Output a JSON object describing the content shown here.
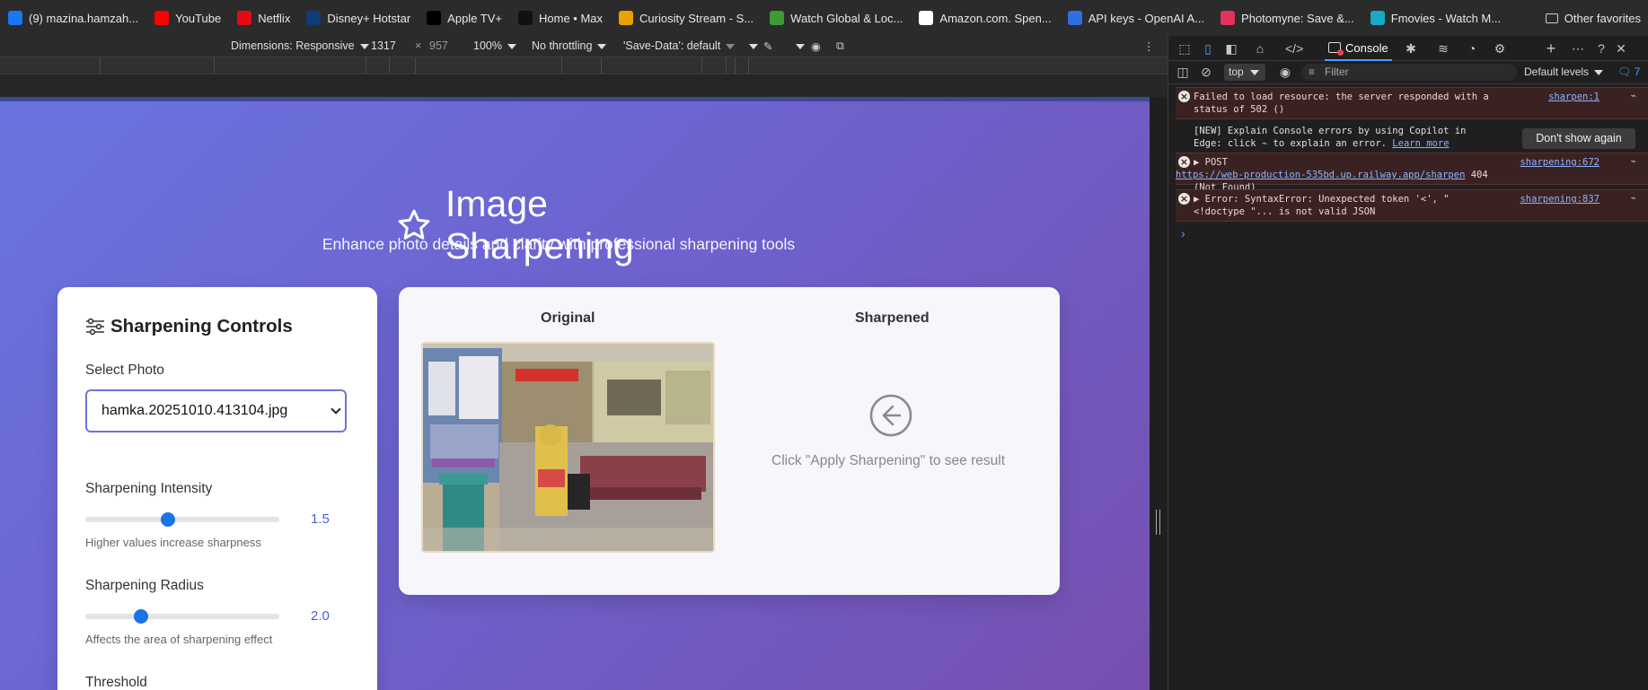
{
  "bookmarks": {
    "items": [
      {
        "label": "(9) mazina.hamzah...",
        "icon": "facebook-icon",
        "color": "#1877f2"
      },
      {
        "label": "YouTube",
        "icon": "youtube-icon",
        "color": "#ff0000"
      },
      {
        "label": "Netflix",
        "icon": "netflix-icon",
        "color": "#e50914"
      },
      {
        "label": "Disney+ Hotstar",
        "icon": "disney-icon",
        "color": "#0f3b7a"
      },
      {
        "label": "Apple TV+",
        "icon": "appletv-icon",
        "color": "#000000"
      },
      {
        "label": "Home • Max",
        "icon": "max-icon",
        "color": "#111111"
      },
      {
        "label": "Curiosity Stream - S...",
        "icon": "curiosity-icon",
        "color": "#e8a200"
      },
      {
        "label": "Watch Global & Loc...",
        "icon": "viki-icon",
        "color": "#3d9b35"
      },
      {
        "label": "Amazon.com. Spen...",
        "icon": "amazon-icon",
        "color": "#ffffff"
      },
      {
        "label": "API keys - OpenAI A...",
        "icon": "openai-icon",
        "color": "#2f6fe0"
      },
      {
        "label": "Photomyne: Save &...",
        "icon": "photomyne-icon",
        "color": "#e2345a"
      },
      {
        "label": "Fmovies - Watch M...",
        "icon": "fmovies-icon",
        "color": "#18a9c4"
      }
    ],
    "other": "Other favorites"
  },
  "device_toolbar": {
    "dimensions": "Dimensions: Responsive",
    "width": "1317",
    "times": "×",
    "height": "957",
    "zoom": "100%",
    "throttling": "No throttling",
    "save_data": "'Save-Data': default"
  },
  "page": {
    "title": "Image Sharpening",
    "subtitle": "Enhance photo details and clarity with professional sharpening tools",
    "controls": {
      "heading": "Sharpening Controls",
      "select_label": "Select Photo",
      "selected_photo": "hamka.20251010.413104.jpg",
      "intensity_label": "Sharpening Intensity",
      "intensity_value": "1.5",
      "intensity_fraction": 0.42,
      "intensity_hint": "Higher values increase sharpness",
      "radius_label": "Sharpening Radius",
      "radius_value": "2.0",
      "radius_fraction": 0.27,
      "radius_hint": "Affects the area of sharpening effect",
      "threshold_label": "Threshold"
    },
    "preview": {
      "original_label": "Original",
      "sharpened_label": "Sharpened",
      "placeholder": "Click \"Apply Sharpening\" to see result"
    }
  },
  "devtools": {
    "active_tab": "Console",
    "context": "top",
    "filter_placeholder": "Filter",
    "levels": "Default levels",
    "message_count": "7",
    "messages": [
      {
        "type": "error",
        "text": "Failed to load resource: the server responded with a status of 502 ()",
        "source": "sharpen:1"
      },
      {
        "type": "info",
        "text_a": "[NEW] Explain Console errors by using Copilot in Edge: click",
        "text_b": "to explain an error.",
        "link": "Learn more",
        "button": "Don't show again"
      },
      {
        "type": "error",
        "method": "POST",
        "url": "https://web-production-535bd.up.railway.app/sharpen",
        "status": "404 (Not Found)",
        "source": "sharpening:672"
      },
      {
        "type": "error",
        "text": "Error: SyntaxError: Unexpected token '<', \"<!doctype \"... is not valid JSON",
        "source": "sharpening:837"
      }
    ],
    "prompt": "›"
  }
}
